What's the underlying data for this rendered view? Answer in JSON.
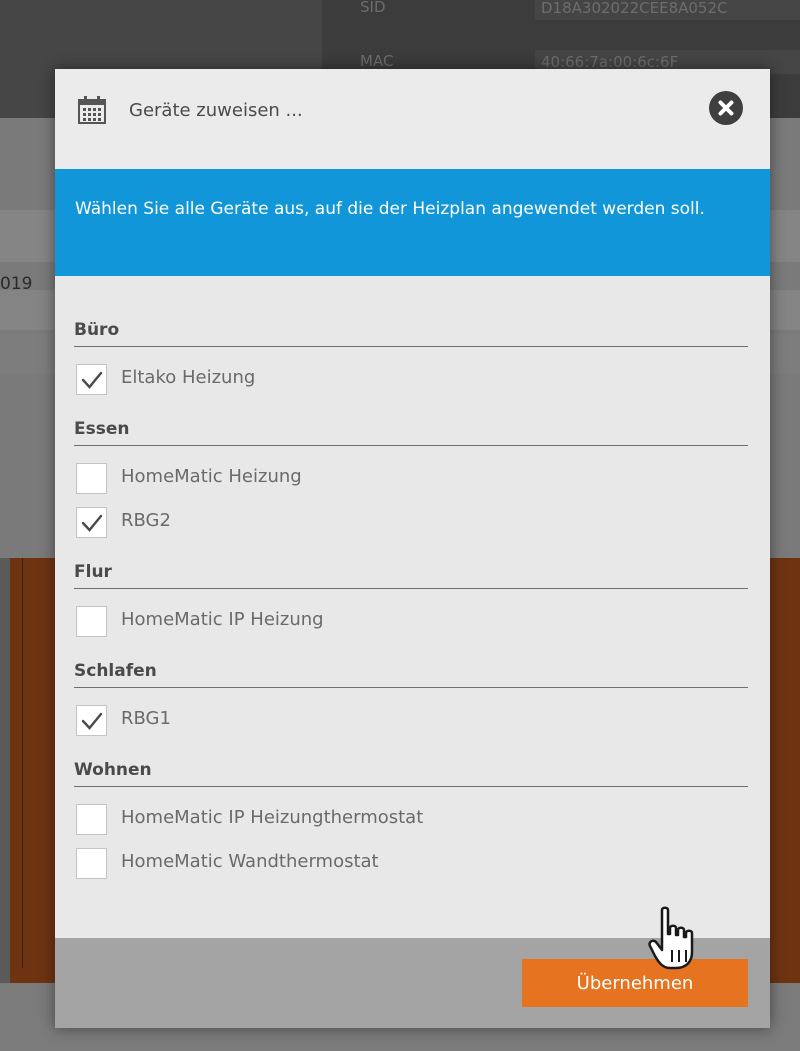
{
  "background": {
    "info_rows": [
      {
        "label": "SID",
        "value": "D18A302022CEE8A052C"
      },
      {
        "label": "MAC",
        "value": "40:66:7a:00:6c:6F"
      }
    ],
    "date_fragment": "019"
  },
  "modal": {
    "icon": "calendar-icon",
    "title": "Geräte zuweisen ...",
    "close_icon": "close-icon",
    "info_text": "Wählen Sie alle Geräte aus, auf die der Heizplan angewendet werden soll.",
    "info_color": "#1196d9",
    "groups": [
      {
        "name": "Büro",
        "devices": [
          {
            "label": "Eltako Heizung",
            "checked": true
          }
        ]
      },
      {
        "name": "Essen",
        "devices": [
          {
            "label": "HomeMatic Heizung",
            "checked": false
          },
          {
            "label": "RBG2",
            "checked": true
          }
        ]
      },
      {
        "name": "Flur",
        "devices": [
          {
            "label": "HomeMatic IP Heizung",
            "checked": false
          }
        ]
      },
      {
        "name": "Schlafen",
        "devices": [
          {
            "label": "RBG1",
            "checked": true
          }
        ]
      },
      {
        "name": "Wohnen",
        "devices": [
          {
            "label": "HomeMatic IP Heizungthermostat",
            "checked": false
          },
          {
            "label": "HomeMatic Wandthermostat",
            "checked": false
          }
        ]
      }
    ],
    "apply_label": "Übernehmen",
    "apply_color": "#e5731f",
    "cursor_icon": "hand-pointer-icon"
  }
}
